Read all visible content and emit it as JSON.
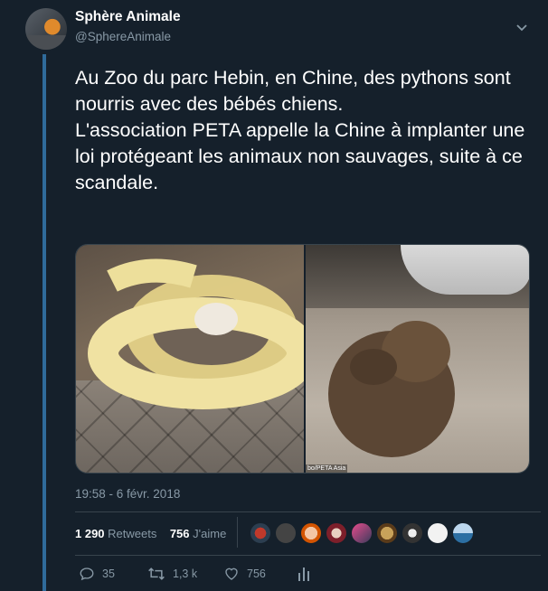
{
  "author": {
    "name": "Sphère Animale",
    "handle": "@SphereAnimale"
  },
  "tweet": {
    "text": "Au Zoo du parc Hebin, en Chine, des pythons sont nourris avec des bébés chiens.\nL'association PETA appelle la Chine à implanter une loi protégeant les animaux non sauvages, suite à ce scandale.",
    "image_credit": "bo/PETA Asia",
    "timestamp": "19:58 - 6 févr. 2018"
  },
  "stats": {
    "retweets_count": "1 290",
    "retweets_label": "Retweets",
    "likes_count": "756",
    "likes_label": "J'aime"
  },
  "actions": {
    "replies": "35",
    "retweets": "1,3 k",
    "likes": "756"
  },
  "icons": {
    "more": "chevron-down-icon",
    "reply": "reply-icon",
    "retweet": "retweet-icon",
    "like": "heart-icon",
    "analytics": "analytics-icon"
  },
  "colors": {
    "background": "#15202b",
    "text": "#ffffff",
    "muted": "#8899a6",
    "thread_line": "#2f6b9b"
  }
}
